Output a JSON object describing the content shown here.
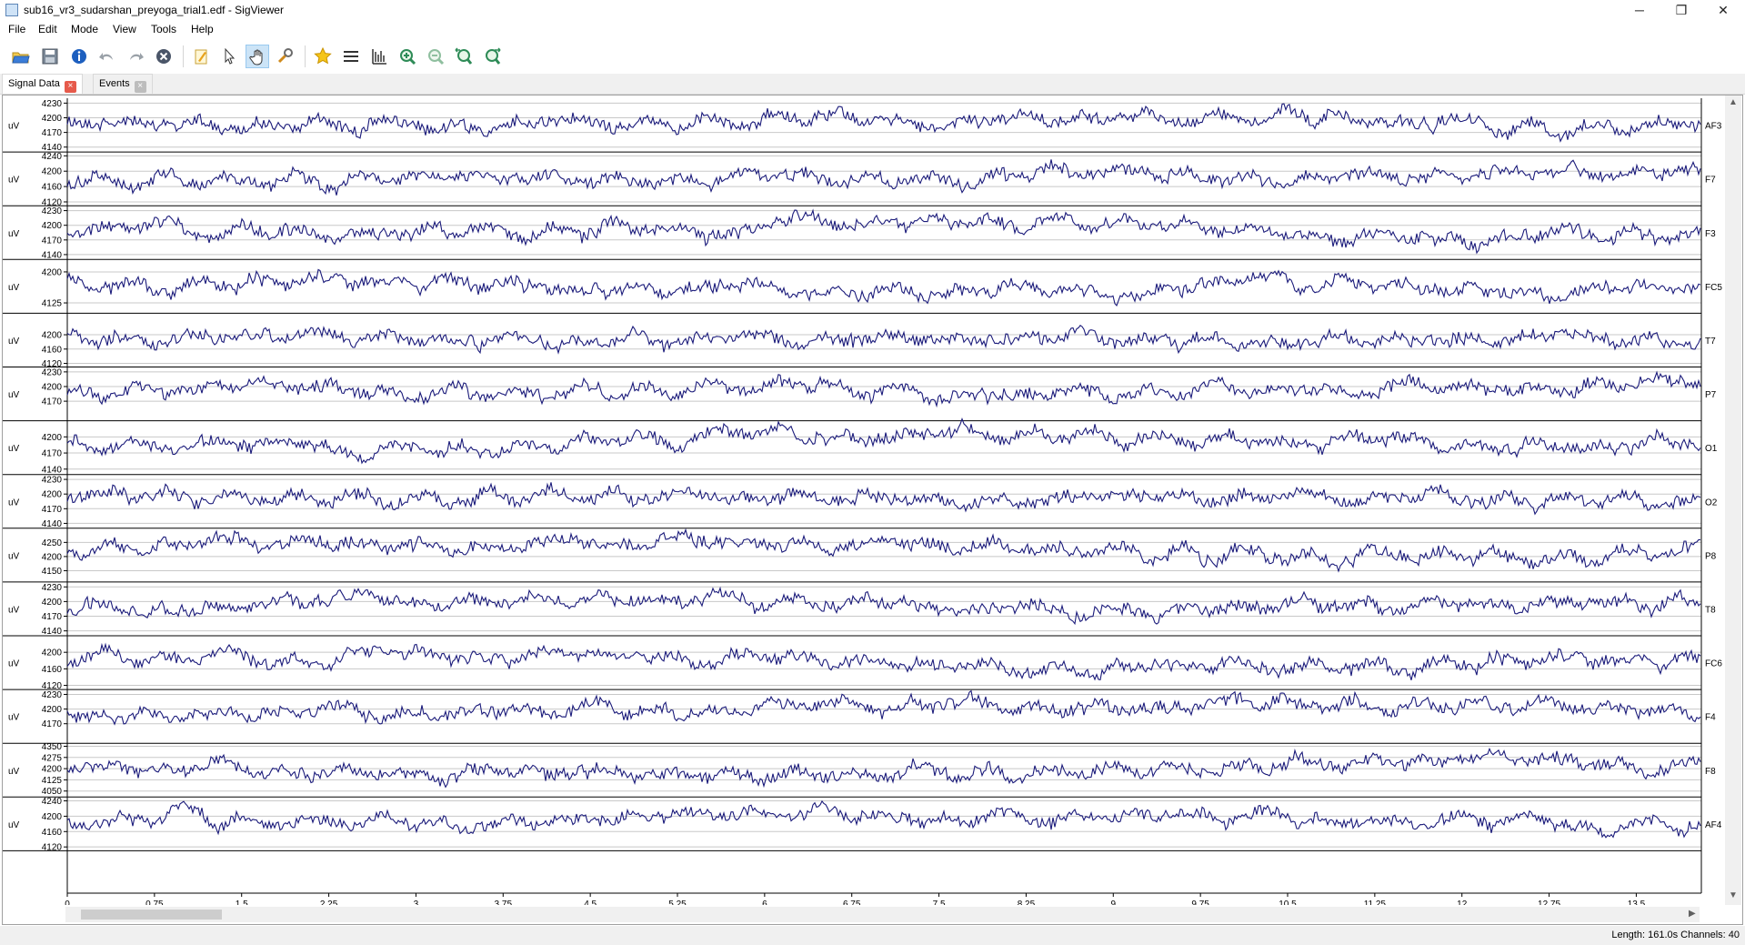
{
  "window": {
    "title": "sub16_vr3_sudarshan_preyoga_trial1.edf - SigViewer",
    "controls": [
      "─",
      "❐",
      "✕"
    ]
  },
  "menu": [
    "File",
    "Edit",
    "Mode",
    "View",
    "Tools",
    "Help"
  ],
  "toolbar": {
    "buttons": [
      "open-icon",
      "save-icon",
      "info-icon",
      "undo-icon",
      "redo-icon",
      "close-file-icon",
      "new-event-mode-icon",
      "pointer-mode-icon",
      "hand-mode-icon",
      "view-options-icon",
      "events-star-icon",
      "channels-icon",
      "scale-icon",
      "zoom-in-vertical-icon",
      "zoom-out-vertical-icon",
      "zoom-in-horizontal-icon",
      "zoom-out-horizontal-icon"
    ],
    "active_button": "hand-mode-icon"
  },
  "tabs": [
    {
      "label": "Signal Data",
      "active": true
    },
    {
      "label": "Events",
      "active": false
    }
  ],
  "chart_data": {
    "type": "line",
    "xlabel": "",
    "xlim": [
      0,
      14.06
    ],
    "x_ticks": [
      "0",
      "0.75",
      "1.5",
      "2.25",
      "3",
      "3.75",
      "4.5",
      "5.25",
      "6",
      "6.75",
      "7.5",
      "8.25",
      "9",
      "9.75",
      "10.5",
      "11.25",
      "12",
      "12.75",
      "13.5"
    ],
    "line_color": "#1a1a7a",
    "grid": true,
    "channels": [
      {
        "name": "AF3",
        "unit": "uV",
        "ylim": [
          4130,
          4240
        ],
        "ticks": [
          "4230",
          "4200",
          "4170",
          "4140"
        ]
      },
      {
        "name": "F7",
        "unit": "uV",
        "ylim": [
          4110,
          4250
        ],
        "ticks": [
          "4240",
          "4200",
          "4160",
          "4120"
        ]
      },
      {
        "name": "F3",
        "unit": "uV",
        "ylim": [
          4130,
          4240
        ],
        "ticks": [
          "4230",
          "4200",
          "4170",
          "4140"
        ]
      },
      {
        "name": "FC5",
        "unit": "uV",
        "ylim": [
          4100,
          4230
        ],
        "ticks": [
          "4200",
          "4125"
        ]
      },
      {
        "name": "T7",
        "unit": "uV",
        "ylim": [
          4110,
          4260
        ],
        "ticks": [
          "4200",
          "4160",
          "4120"
        ]
      },
      {
        "name": "P7",
        "unit": "uV",
        "ylim": [
          4130,
          4240
        ],
        "ticks": [
          "4230",
          "4200",
          "4170"
        ]
      },
      {
        "name": "O1",
        "unit": "uV",
        "ylim": [
          4130,
          4230
        ],
        "ticks": [
          "4200",
          "4170",
          "4140"
        ]
      },
      {
        "name": "O2",
        "unit": "uV",
        "ylim": [
          4130,
          4240
        ],
        "ticks": [
          "4230",
          "4200",
          "4170",
          "4140"
        ]
      },
      {
        "name": "P8",
        "unit": "uV",
        "ylim": [
          4110,
          4300
        ],
        "ticks": [
          "4250",
          "4200",
          "4150"
        ]
      },
      {
        "name": "T8",
        "unit": "uV",
        "ylim": [
          4130,
          4240
        ],
        "ticks": [
          "4230",
          "4200",
          "4170",
          "4140"
        ]
      },
      {
        "name": "FC6",
        "unit": "uV",
        "ylim": [
          4110,
          4240
        ],
        "ticks": [
          "4200",
          "4160",
          "4120"
        ]
      },
      {
        "name": "F4",
        "unit": "uV",
        "ylim": [
          4130,
          4240
        ],
        "ticks": [
          "4230",
          "4200",
          "4170"
        ]
      },
      {
        "name": "F8",
        "unit": "uV",
        "ylim": [
          4010,
          4370
        ],
        "ticks": [
          "4350",
          "4275",
          "4200",
          "4125",
          "4050"
        ]
      },
      {
        "name": "AF4",
        "unit": "uV",
        "ylim": [
          4110,
          4250
        ],
        "ticks": [
          "4240",
          "4200",
          "4160",
          "4120"
        ]
      }
    ]
  },
  "status": "Length: 161.0s  Channels: 40"
}
